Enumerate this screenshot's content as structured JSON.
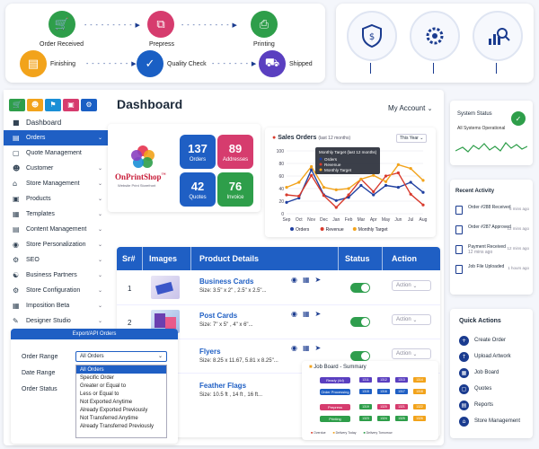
{
  "workflow": {
    "steps": [
      {
        "label": "Order Received",
        "icon": "cart-icon",
        "color": "#2e9e4a"
      },
      {
        "label": "Prepress",
        "icon": "layers-icon",
        "color": "#d63c6e"
      },
      {
        "label": "Printing",
        "icon": "printer-icon",
        "color": "#2e9e4a"
      },
      {
        "label": "Finishing",
        "icon": "finishing-icon",
        "color": "#f2a31b"
      },
      {
        "label": "Quality Check",
        "icon": "shield-check-icon",
        "color": "#1a5fc4"
      },
      {
        "label": "Shipped",
        "icon": "truck-icon",
        "color": "#5a3fc0"
      }
    ]
  },
  "feature_icons": [
    "security-settings-icon",
    "gear-settings-icon",
    "analytics-icon"
  ],
  "sidebar": {
    "top_icons": [
      {
        "name": "cart-tab-icon",
        "color": "#2e9e4a"
      },
      {
        "name": "user-tab-icon",
        "color": "#f2a31b"
      },
      {
        "name": "tag-tab-icon",
        "color": "#1a8fd6"
      },
      {
        "name": "box-tab-icon",
        "color": "#d63c6e"
      },
      {
        "name": "settings-tab-icon",
        "color": "#1a5fc4"
      }
    ],
    "items": [
      {
        "label": "Dashboard",
        "icon": "dashboard-icon",
        "chev": false,
        "active": false
      },
      {
        "label": "Orders",
        "icon": "orders-icon",
        "chev": true,
        "active": true
      },
      {
        "label": "Quote Management",
        "icon": "quote-icon",
        "chev": false,
        "active": false
      },
      {
        "label": "Customer",
        "icon": "customer-icon",
        "chev": true,
        "active": false
      },
      {
        "label": "Store Management",
        "icon": "store-icon",
        "chev": true,
        "active": false
      },
      {
        "label": "Products",
        "icon": "products-icon",
        "chev": true,
        "active": false
      },
      {
        "label": "Templates",
        "icon": "templates-icon",
        "chev": true,
        "active": false
      },
      {
        "label": "Content Management",
        "icon": "content-icon",
        "chev": true,
        "active": false
      },
      {
        "label": "Store Personalization",
        "icon": "personalization-icon",
        "chev": true,
        "active": false
      },
      {
        "label": "SEO",
        "icon": "seo-icon",
        "chev": true,
        "active": false
      },
      {
        "label": "Business Partners",
        "icon": "partners-icon",
        "chev": true,
        "active": false
      },
      {
        "label": "Store Configuration",
        "icon": "config-icon",
        "chev": true,
        "active": false
      },
      {
        "label": "Imposition Beta",
        "icon": "imposition-icon",
        "chev": true,
        "active": false
      },
      {
        "label": "Designer Studio",
        "icon": "designer-icon",
        "chev": true,
        "active": false
      }
    ]
  },
  "header": {
    "title": "Dashboard",
    "account": "My Account"
  },
  "logo": {
    "brand": "OnPrintShop",
    "tm": "™",
    "tagline": "Website Print Storefront"
  },
  "stats": [
    {
      "value": "137",
      "label": "Orders",
      "color": "#1f5fc4"
    },
    {
      "value": "89",
      "label": "Addresses",
      "color": "#d63c6e"
    },
    {
      "value": "42",
      "label": "Quotes",
      "color": "#1f5fc4"
    },
    {
      "value": "76",
      "label": "Invoice",
      "color": "#2e9e4a"
    }
  ],
  "chart_data": {
    "type": "line",
    "title": "Sales Orders",
    "subtitle": "(last 12 months)",
    "period": "This Year",
    "categories": [
      "Sep",
      "Oct",
      "Nov",
      "Dec",
      "Jan",
      "Feb",
      "Mar",
      "Apr",
      "May",
      "Jun",
      "Jul",
      "Aug"
    ],
    "ylim": [
      0,
      100
    ],
    "yticks": [
      "100",
      "80",
      "60",
      "40",
      "20",
      "0"
    ],
    "series": [
      {
        "name": "Orders",
        "color": "#1f3fa0",
        "values": [
          18,
          25,
          70,
          30,
          21,
          26,
          45,
          30,
          45,
          42,
          50,
          34
        ]
      },
      {
        "name": "Revenue",
        "color": "#d83a2c",
        "values": [
          30,
          28,
          61,
          29,
          10,
          30,
          55,
          35,
          60,
          65,
          31,
          14
        ]
      },
      {
        "name": "Monthly Target",
        "color": "#f2a31b",
        "values": [
          42,
          50,
          75,
          42,
          38,
          40,
          55,
          61,
          51,
          78,
          72,
          53
        ]
      }
    ],
    "tooltip": {
      "title": "Monthly Target (last 12 months)",
      "lines": [
        "Orders",
        "Revenue",
        "Monthly Target"
      ]
    }
  },
  "table": {
    "headers": {
      "sr": "Sr#",
      "images": "Images",
      "details": "Product Details",
      "status": "Status",
      "action": "Action"
    },
    "rows": [
      {
        "sr": "1",
        "name": "Business Cards",
        "size": "Size: 3.5\" x 2\" , 2.5\" x 2.5\"...",
        "action": "Action"
      },
      {
        "sr": "2",
        "name": "Post Cards",
        "size": "Size: 7\" x 5\" , 4\" x 6\"...",
        "action": "Action"
      },
      {
        "sr": "",
        "name": "Flyers",
        "size": "Size: 8.25 x 11.67, 5.81 x 8.25\"...",
        "action": "Action"
      },
      {
        "sr": "",
        "name": "Feather Flags",
        "size": "Size: 10.5 ft , 14 ft , 16 ft...",
        "action": "Action"
      }
    ]
  },
  "export_panel": {
    "title": "Export/API Orders",
    "labels": [
      "Order Range",
      "Date Range",
      "Order Status"
    ],
    "selected": "All Orders",
    "options": [
      "All Orders",
      "Specific Order",
      "Greater or Equal to",
      "Less or Equal to",
      "Not Exported Anytime",
      "Already Exported Previously",
      "Not Transferred Anytime",
      "Already Transferred Previously"
    ]
  },
  "job_board": {
    "title": "Job Board - Summary",
    "rows": [
      {
        "label": "Ready (4d)",
        "color": "#5a3fc0",
        "cells": [
          "1311",
          "1312",
          "1313",
          "1314"
        ],
        "cell_colors": [
          "#5a3fc0",
          "#5a3fc0",
          "#5a3fc0",
          "#f2a31b"
        ]
      },
      {
        "label": "Order Processing",
        "color": "#1f5fc4",
        "cells": [
          "1315",
          "1316",
          "1317",
          "1318"
        ],
        "cell_colors": [
          "#1f5fc4",
          "#1f5fc4",
          "#1f5fc4",
          "#f2a31b"
        ]
      },
      {
        "label": "Prepress",
        "color": "#d63c6e",
        "cells": [
          "1319",
          "1320",
          "1321",
          "1322"
        ],
        "cell_colors": [
          "#2e9e4a",
          "#d63c6e",
          "#d63c6e",
          "#f2a31b"
        ]
      },
      {
        "label": "Printing",
        "color": "#2e9e4a",
        "cells": [
          "1323",
          "1324",
          "1325",
          "1326"
        ],
        "cell_colors": [
          "#2e9e4a",
          "#2e9e4a",
          "#2e9e4a",
          "#f2a31b"
        ]
      }
    ],
    "legend": [
      {
        "label": "Overdue",
        "color": "#d83a2c"
      },
      {
        "label": "Delivery Today",
        "color": "#f2a31b"
      },
      {
        "label": "Delivery Tomorrow",
        "color": "#2e9e4a"
      }
    ]
  },
  "system_status": {
    "title": "System Status",
    "text": "All Systems Operational"
  },
  "recent_activity": {
    "title": "Recent Activity",
    "items": [
      {
        "text": "Order #288 Received",
        "time": "5 mins ago"
      },
      {
        "text": "Order #287 Approved",
        "time": "12 mins ago"
      },
      {
        "text": "Payment Received",
        "sub": "12 mins ago",
        "time": "12 mins ago"
      },
      {
        "text": "Job File Uploaded",
        "time": "1 hours ago"
      }
    ]
  },
  "quick_actions": {
    "title": "Quick Actions",
    "items": [
      "Create Order",
      "Upload Artwork",
      "Job Board",
      "Quotes",
      "Reports",
      "Store Management"
    ]
  }
}
